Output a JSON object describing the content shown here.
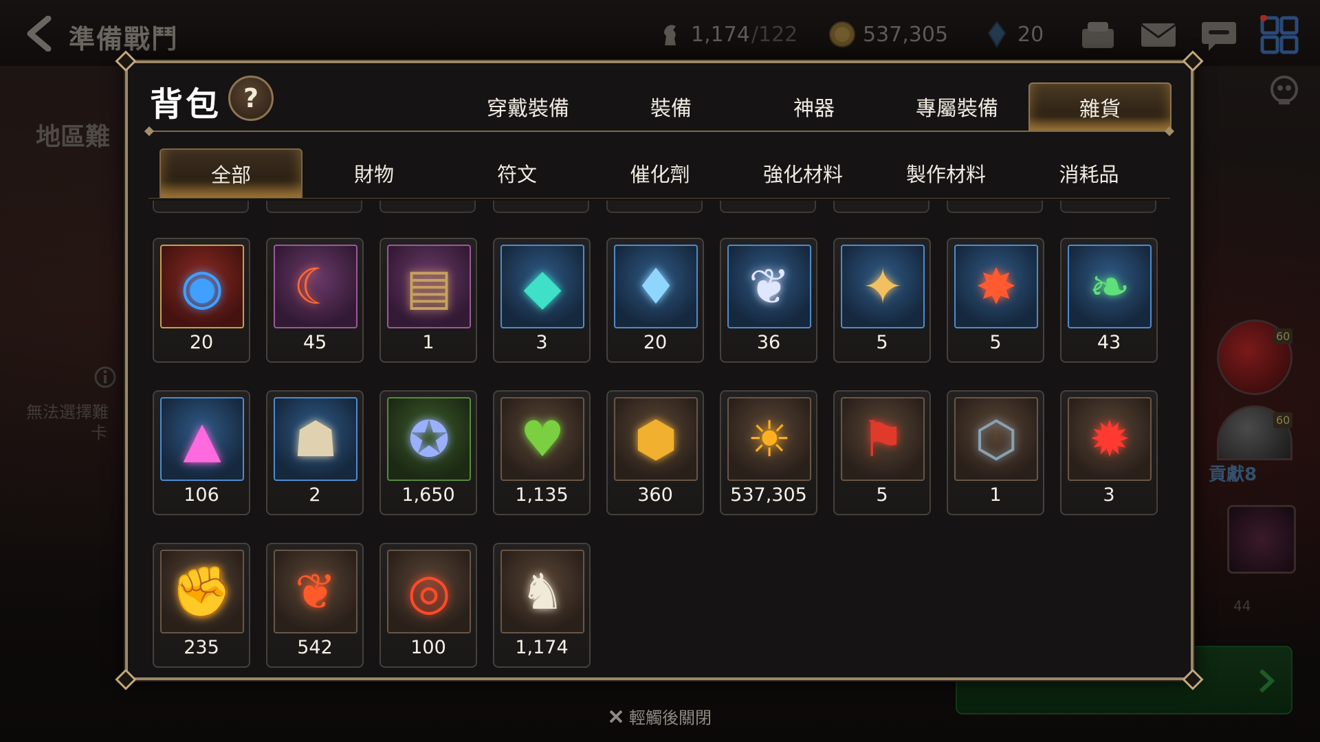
{
  "header": {
    "title": "準備戰鬥",
    "currencies": [
      {
        "icon": "horse-token-icon",
        "value": "1,174",
        "cap": "/122"
      },
      {
        "icon": "gold-coin-icon",
        "value": "537,305",
        "cap": ""
      },
      {
        "icon": "blue-crystal-icon",
        "value": "20",
        "cap": ""
      }
    ]
  },
  "background": {
    "region_label": "地區難",
    "info_text_line1": "無法選擇難",
    "info_text_line2": "卡",
    "contribution": "貢獻8",
    "level_badges": [
      "60",
      "60"
    ],
    "portrait_level": "44"
  },
  "modal": {
    "title": "背包",
    "help_label": "?",
    "main_tabs": [
      {
        "label": "穿戴裝備",
        "active": false
      },
      {
        "label": "裝備",
        "active": false
      },
      {
        "label": "神器",
        "active": false
      },
      {
        "label": "專屬裝備",
        "active": false
      },
      {
        "label": "雜貨",
        "active": true
      }
    ],
    "sub_tabs": [
      {
        "label": "全部",
        "active": true
      },
      {
        "label": "財物",
        "active": false
      },
      {
        "label": "符文",
        "active": false
      },
      {
        "label": "催化劑",
        "active": false
      },
      {
        "label": "強化材料",
        "active": false
      },
      {
        "label": "製作材料",
        "active": false
      },
      {
        "label": "消耗品",
        "active": false
      }
    ],
    "items": [
      {
        "icon": "eye-emblem-icon",
        "glyph": "◉",
        "color": "#3fa0ff",
        "bg": "red",
        "count": "20"
      },
      {
        "icon": "flame-crescent-icon",
        "glyph": "☾",
        "color": "#ff6a3a",
        "bg": "purple",
        "count": "45"
      },
      {
        "icon": "treasure-map-icon",
        "glyph": "▤",
        "color": "#c8a060",
        "bg": "purple",
        "count": "1"
      },
      {
        "icon": "teal-crystal-icon",
        "glyph": "◆",
        "color": "#3ee0c8",
        "bg": "blue",
        "count": "3"
      },
      {
        "icon": "blue-gem-icon",
        "glyph": "♦",
        "color": "#8fd6ff",
        "bg": "blue",
        "count": "20"
      },
      {
        "icon": "white-coral-icon",
        "glyph": "❦",
        "color": "#dfe6ff",
        "bg": "blue",
        "count": "36"
      },
      {
        "icon": "star-compass-icon",
        "glyph": "✦",
        "color": "#f2c060",
        "bg": "blue",
        "count": "5"
      },
      {
        "icon": "fire-tail-icon",
        "glyph": "✸",
        "color": "#ff5a30",
        "bg": "blue",
        "count": "5"
      },
      {
        "icon": "green-leaf-icon",
        "glyph": "❧",
        "color": "#5ee07a",
        "bg": "blue",
        "count": "43"
      },
      {
        "icon": "pink-crystal-pile-icon",
        "glyph": "▲",
        "color": "#ff6adf",
        "bg": "blue",
        "count": "106"
      },
      {
        "icon": "wanted-poster-icon",
        "glyph": "☗",
        "color": "#e0d2b0",
        "bg": "blue",
        "count": "2"
      },
      {
        "icon": "fist-crest-icon",
        "glyph": "✪",
        "color": "#9ab0ff",
        "bg": "green",
        "count": "1,650"
      },
      {
        "icon": "green-heart-icon",
        "glyph": "♥",
        "color": "#7ad040",
        "bg": "brown",
        "count": "1,135"
      },
      {
        "icon": "golden-shield-icon",
        "glyph": "⬢",
        "color": "#f2b030",
        "bg": "brown",
        "count": "360"
      },
      {
        "icon": "gold-coin-icon",
        "glyph": "☀",
        "color": "#ffb020",
        "bg": "brown",
        "count": "537,305"
      },
      {
        "icon": "war-banner-icon",
        "glyph": "⚑",
        "color": "#e03a2a",
        "bg": "brown",
        "count": "5"
      },
      {
        "icon": "stone-compass-icon",
        "glyph": "⬡",
        "color": "#8aa0b0",
        "bg": "brown",
        "count": "1"
      },
      {
        "icon": "red-seal-icon",
        "glyph": "✹",
        "color": "#ff3a30",
        "bg": "brown",
        "count": "3"
      },
      {
        "icon": "fist-badge-icon",
        "glyph": "✊",
        "color": "#f2b030",
        "bg": "brown",
        "count": "235"
      },
      {
        "icon": "red-wings-icon",
        "glyph": "❦",
        "color": "#ff5a2a",
        "bg": "brown",
        "count": "542"
      },
      {
        "icon": "red-bracelet-icon",
        "glyph": "◎",
        "color": "#ff4a2a",
        "bg": "brown",
        "count": "100"
      },
      {
        "icon": "knight-chess-icon",
        "glyph": "♞",
        "color": "#f2ead8",
        "bg": "brown",
        "count": "1,174"
      }
    ]
  },
  "footer": {
    "close_hint": "輕觸後關閉"
  }
}
